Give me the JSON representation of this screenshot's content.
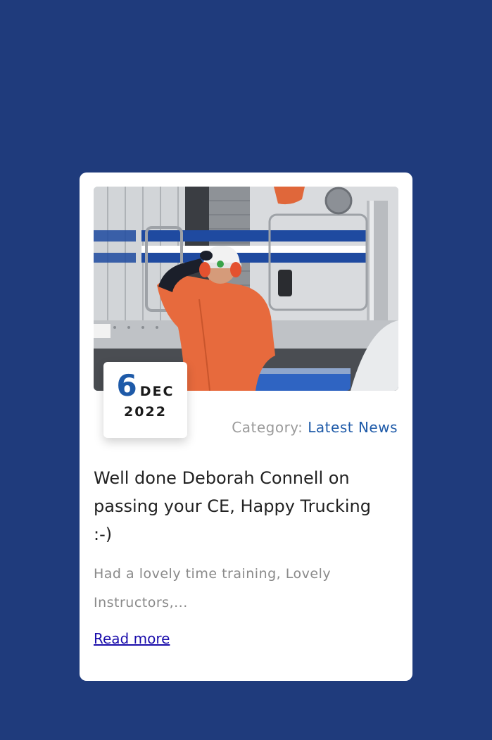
{
  "post": {
    "image_alt": "Trucker in orange workwear and hard hat beside a silver truck",
    "date": {
      "day": "6",
      "month": "DEC",
      "year": "2022"
    },
    "category_label": "Category:",
    "category_value": "Latest News",
    "title": "Well done Deborah Connell on passing your CE, Happy Trucking :-)",
    "excerpt": "Had a lovely time training, Lovely Instructors,...",
    "read_more": "Read more"
  },
  "colors": {
    "page_background": "#1f3b7c",
    "card_background": "#ffffff",
    "accent_blue": "#1e5aa8",
    "link": "#1a0dab"
  }
}
